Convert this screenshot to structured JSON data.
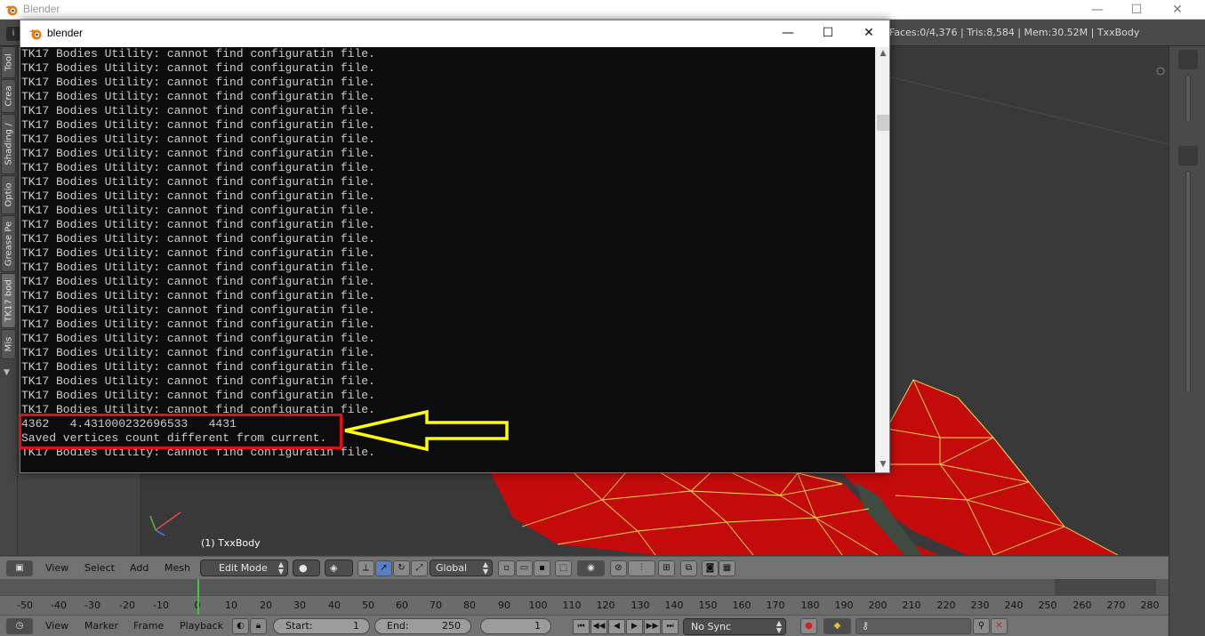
{
  "app": {
    "title": "Blender",
    "window_controls": {
      "minimize": "—",
      "maximize": "☐",
      "close": "✕"
    }
  },
  "info_header": {
    "stats": "Faces:0/4,376 | Tris:8,584 | Mem:30.52M | TxxBody",
    "info_icon": "i"
  },
  "tool_shelf": {
    "tabs": [
      "Tool",
      "Crea",
      "Shading /",
      "Optio",
      "Grease Pe",
      "TK17 bod",
      "Mis"
    ],
    "expand_arrow": "▼"
  },
  "viewport": {
    "object_label": "(1) TxxBody",
    "mesh_color": "#cc0d0d",
    "edge_color": "#f2e24a"
  },
  "console": {
    "title": "blender",
    "controls": {
      "minimize": "—",
      "maximize": "☐",
      "close": "✕"
    },
    "repeated_line": "TK17 Bodies Utility: cannot find configuratin file.",
    "repeat_count": 26,
    "highlight_lines": [
      "4362   4.431000232696533   4431",
      "Saved vertices count different from current."
    ],
    "last_line": "TK17 Bodies Utility: cannot find configuratin file.",
    "scroll_up": "▲",
    "scroll_down": "▼"
  },
  "annotation": {
    "box_color": "#e0101a",
    "arrow_color": "#ffff00"
  },
  "view_header": {
    "menus": [
      "View",
      "Select",
      "Add",
      "Mesh"
    ],
    "mode": "Edit Mode",
    "orientation": "Global"
  },
  "timeline": {
    "ruler": [
      "-50",
      "-40",
      "-30",
      "-20",
      "-10",
      "0",
      "10",
      "20",
      "30",
      "40",
      "50",
      "60",
      "70",
      "80",
      "90",
      "100",
      "110",
      "120",
      "130",
      "140",
      "150",
      "160",
      "170",
      "180",
      "190",
      "200",
      "210",
      "220",
      "230",
      "240",
      "250",
      "260",
      "270",
      "280"
    ],
    "current_frame_marker": 0,
    "menus": [
      "View",
      "Marker",
      "Frame",
      "Playback"
    ],
    "start_label": "Start:",
    "start_value": "1",
    "end_label": "End:",
    "end_value": "250",
    "current_frame": "1",
    "sync": "No Sync",
    "playback_buttons": [
      "⏮",
      "◀◀",
      "◀",
      "▶",
      "▶▶",
      "⏭"
    ]
  }
}
